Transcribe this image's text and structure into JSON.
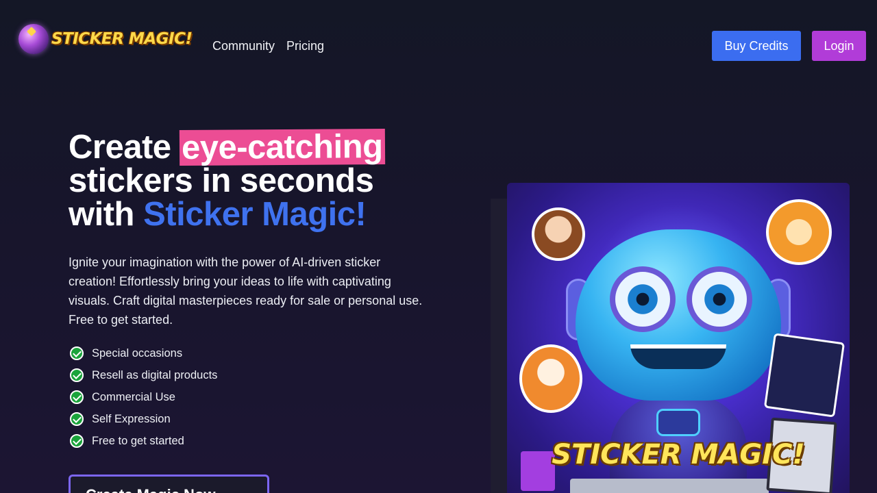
{
  "header": {
    "logo_text": "STICKER MAGIC!",
    "nav": [
      {
        "label": "Community"
      },
      {
        "label": "Pricing"
      }
    ],
    "buy_credits_label": "Buy Credits",
    "login_label": "Login"
  },
  "hero": {
    "title_part1": "Create ",
    "title_highlight": "eye-catching",
    "title_part2": "stickers in seconds",
    "title_part3": "with ",
    "title_brand": "Sticker Magic!",
    "description": "Ignite your imagination with the power of AI-driven sticker creation! Effortlessly bring your ideas to life with captivating visuals. Craft digital masterpieces ready for sale or personal use. Free to get started.",
    "features": [
      "Special occasions",
      "Resell as digital products",
      "Commercial Use",
      "Self Expression",
      "Free to get started"
    ],
    "cta_label": "Create Magic Now"
  },
  "showcase": {
    "image_label": "STICKER MAGIC!"
  },
  "colors": {
    "background": "#161629",
    "buy_credits_button": "#3b6df0",
    "login_button": "#b13cd8",
    "highlight": "#ec4d94",
    "brand_blue": "#3f72ef",
    "check_green": "#1aa33b",
    "cta_border": "#7c66f2"
  },
  "icons": [
    "magic-orb-logo-icon",
    "check-circle-icon"
  ]
}
